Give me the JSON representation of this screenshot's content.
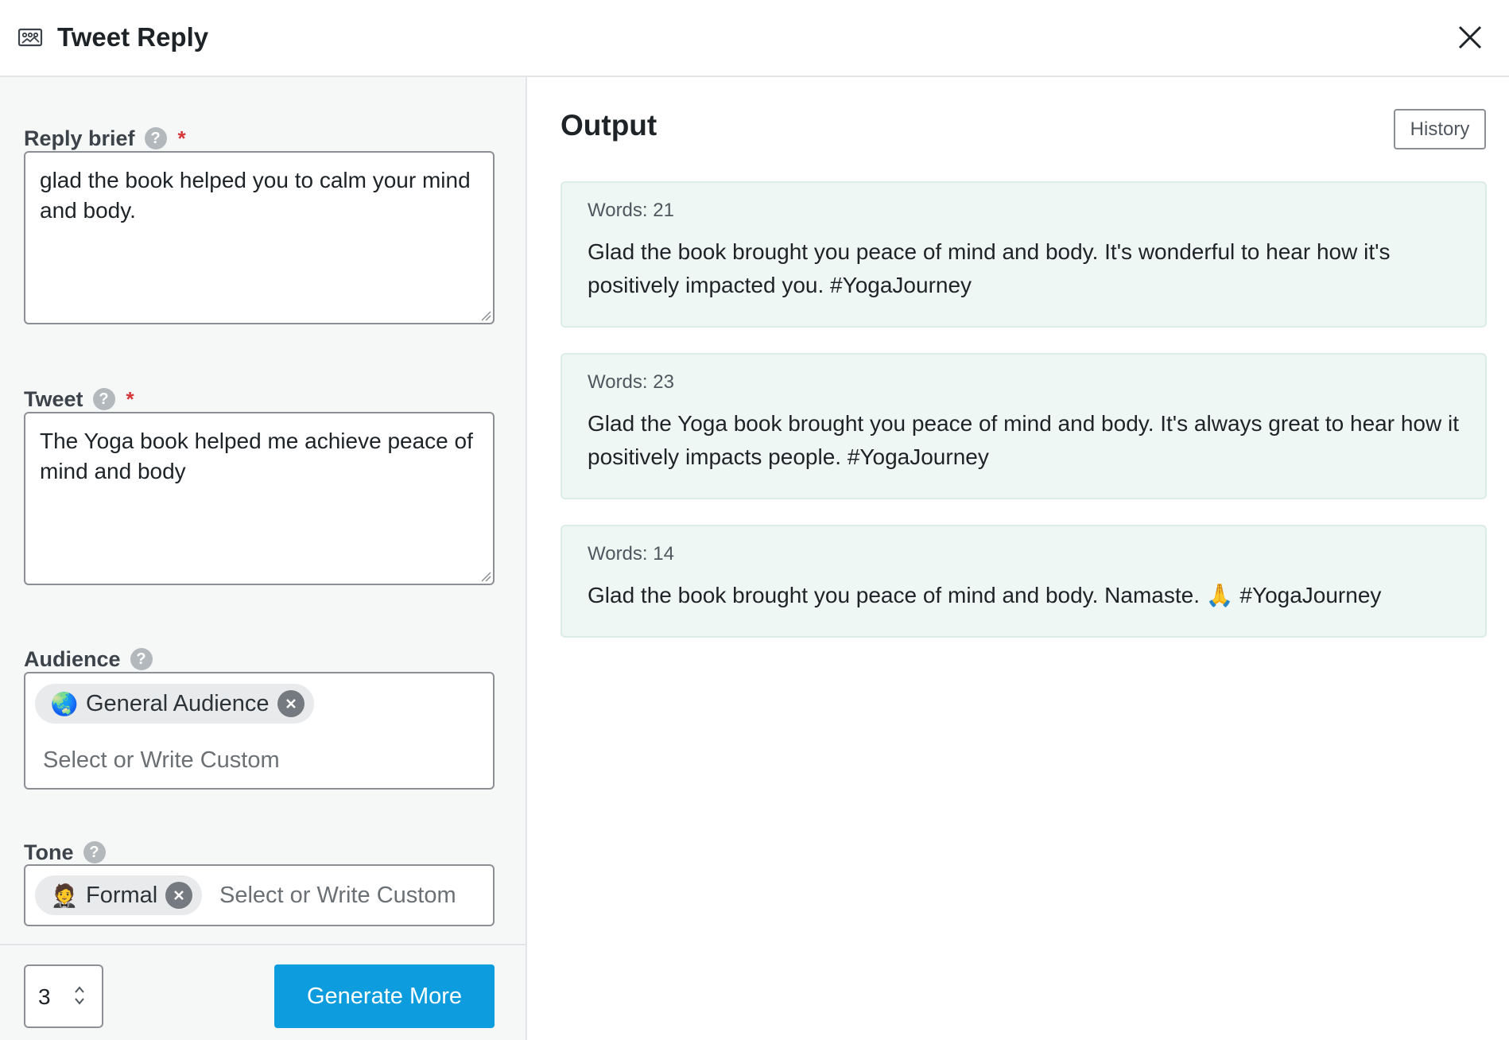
{
  "header": {
    "title": "Tweet Reply",
    "app_icon": "image-icon",
    "close_icon": "close-icon"
  },
  "form": {
    "reply_brief": {
      "label": "Reply brief",
      "required_mark": "*",
      "value": "glad the book helped you to calm your mind and body."
    },
    "tweet": {
      "label": "Tweet",
      "required_mark": "*",
      "value": "The Yoga book helped me achieve peace of mind and body"
    },
    "audience": {
      "label": "Audience",
      "chip_emoji": "🌏",
      "chip_label": "General Audience",
      "placeholder": "Select or Write Custom"
    },
    "tone": {
      "label": "Tone",
      "chip_emoji": "🤵",
      "chip_label": "Formal",
      "placeholder": "Select or Write Custom"
    },
    "help_glyph": "?",
    "quantity": "3",
    "generate_label": "Generate More"
  },
  "output": {
    "title": "Output",
    "history_label": "History",
    "results": [
      {
        "words": "Words: 21",
        "text": "Glad the book brought you peace of mind and body. It's wonderful to hear how it's positively impacted you. #YogaJourney"
      },
      {
        "words": "Words: 23",
        "text": "Glad the Yoga book brought you peace of mind and body. It's always great to hear how it positively impacts people. #YogaJourney"
      },
      {
        "words": "Words: 14",
        "text": "Glad the book brought you peace of mind and body. Namaste. 🙏 #YogaJourney"
      }
    ]
  },
  "colors": {
    "accent": "#0d9ddf",
    "required": "#d63638",
    "output_card_bg": "#eef7f4"
  }
}
